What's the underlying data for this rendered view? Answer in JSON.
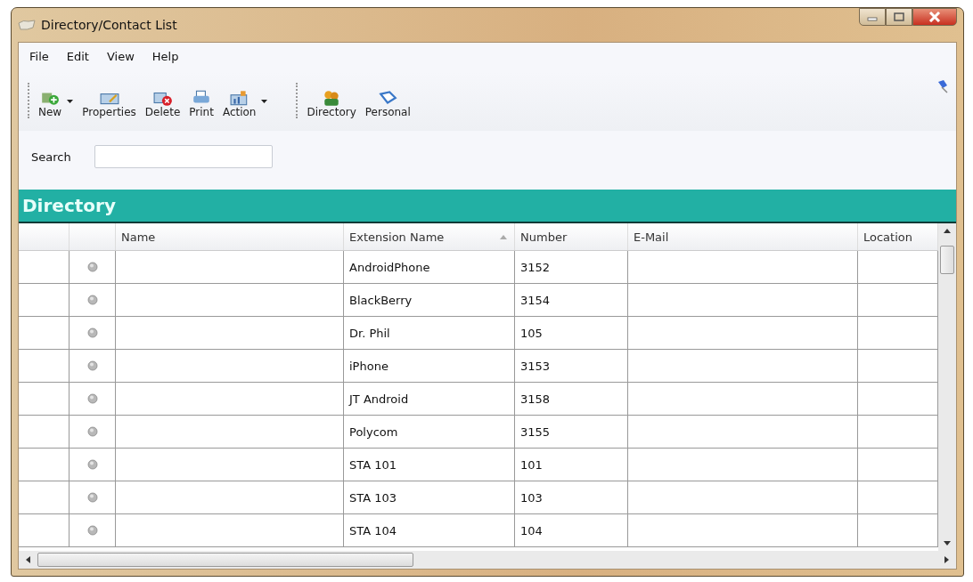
{
  "window": {
    "title": "Directory/Contact List"
  },
  "menu": [
    "File",
    "Edit",
    "View",
    "Help"
  ],
  "toolbar": [
    [
      {
        "kind": "new",
        "label": "New",
        "dropdown": true
      },
      {
        "kind": "properties",
        "label": "Properties",
        "dropdown": false
      },
      {
        "kind": "delete",
        "label": "Delete",
        "dropdown": false
      },
      {
        "kind": "print",
        "label": "Print",
        "dropdown": false
      },
      {
        "kind": "action",
        "label": "Action",
        "dropdown": true
      }
    ],
    [
      {
        "kind": "directory",
        "label": "Directory",
        "dropdown": false
      },
      {
        "kind": "personal",
        "label": "Personal",
        "dropdown": false
      }
    ]
  ],
  "search": {
    "label": "Search"
  },
  "section_title": "Directory",
  "table": {
    "columns": [
      {
        "label": "Name",
        "sorted": false
      },
      {
        "label": "Extension Name",
        "sorted": true
      },
      {
        "label": "Number",
        "sorted": false
      },
      {
        "label": "E-Mail",
        "sorted": false
      },
      {
        "label": "Location",
        "sorted": false
      }
    ],
    "rows": [
      {
        "extension_name": "AndroidPhone",
        "number": "3152"
      },
      {
        "extension_name": "BlackBerry",
        "number": "3154"
      },
      {
        "extension_name": "Dr. Phil",
        "number": "105"
      },
      {
        "extension_name": "iPhone",
        "number": "3153"
      },
      {
        "extension_name": "JT Android",
        "number": "3158"
      },
      {
        "extension_name": "Polycom",
        "number": "3155"
      },
      {
        "extension_name": "STA 101",
        "number": "101"
      },
      {
        "extension_name": "STA 103",
        "number": "103"
      },
      {
        "extension_name": "STA 104",
        "number": "104"
      }
    ]
  }
}
